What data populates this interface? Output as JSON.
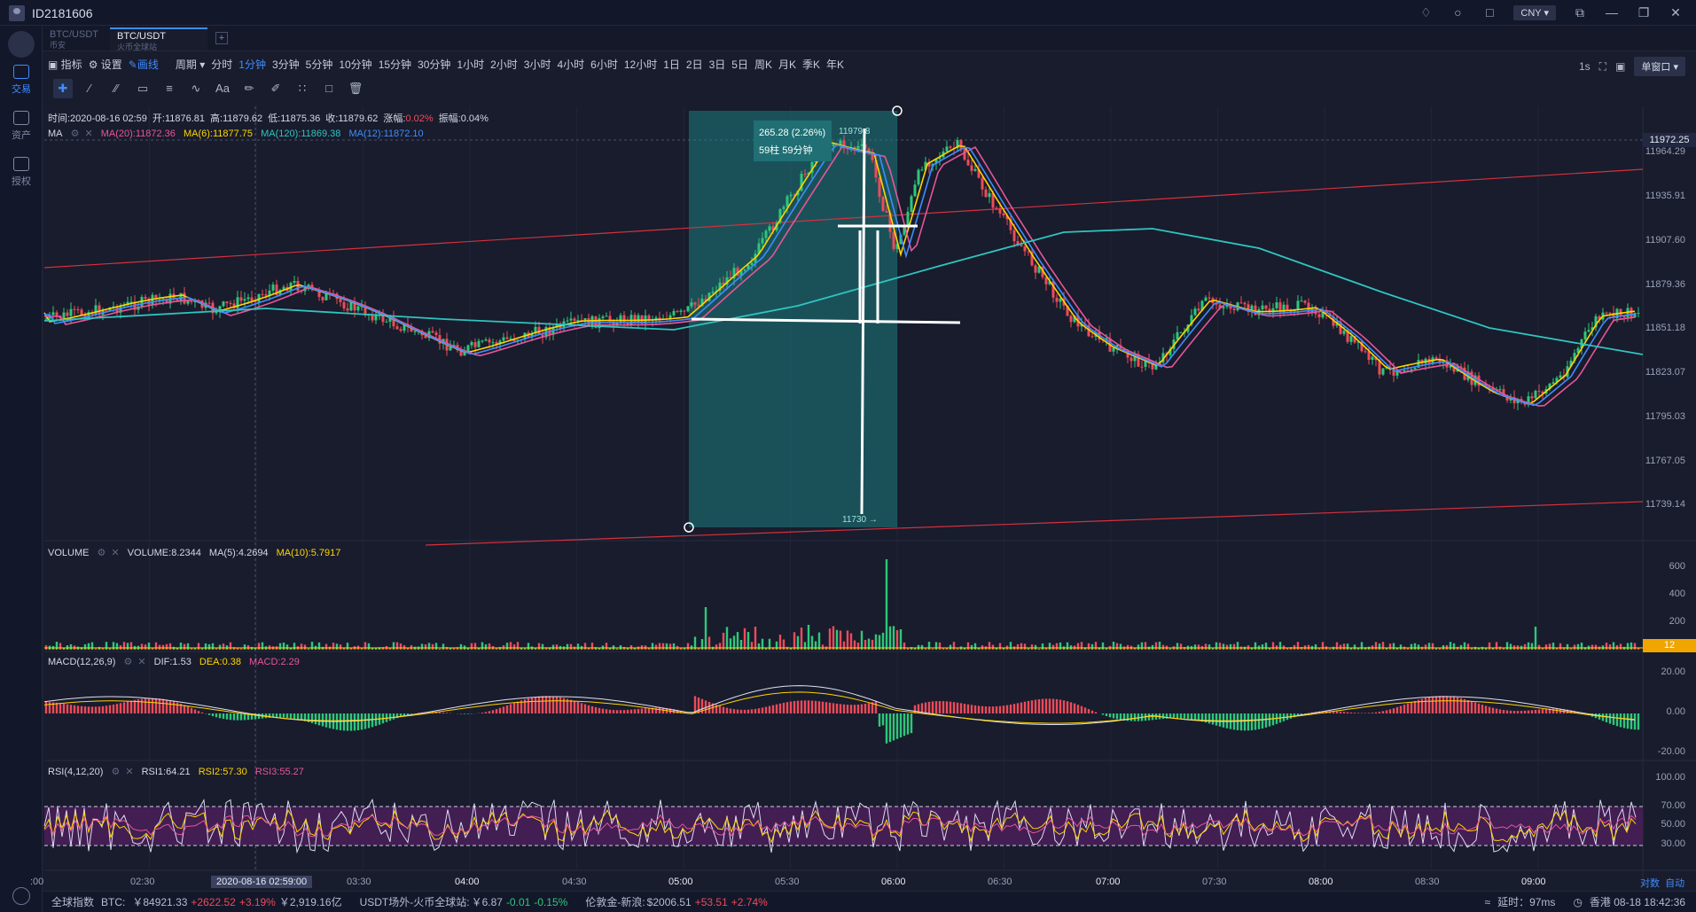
{
  "window": {
    "user_id": "ID2181606",
    "currency": "CNY"
  },
  "sidebar": {
    "items": [
      {
        "label": "交易",
        "icon": "trade-icon"
      },
      {
        "label": "资产",
        "icon": "wallet-icon"
      },
      {
        "label": "授权",
        "icon": "auth-icon"
      }
    ]
  },
  "tabs": [
    {
      "label": "BTC/USDT",
      "sub": "币安"
    },
    {
      "label": "BTC/USDT",
      "sub": "火币全球站"
    }
  ],
  "toolbar": {
    "indicator": "指标",
    "settings": "设置",
    "draw": "画线",
    "period": "周期",
    "intervals": [
      "分时",
      "1分钟",
      "3分钟",
      "5分钟",
      "10分钟",
      "15分钟",
      "30分钟",
      "1小时",
      "2小时",
      "3小时",
      "4小时",
      "6小时",
      "12小时",
      "1日",
      "2日",
      "3日",
      "5日",
      "周K",
      "月K",
      "季K",
      "年K"
    ],
    "active_interval": "1分钟",
    "refresh": "1s",
    "window_mode": "单窗口"
  },
  "info_line": {
    "time": "时间:2020-08-16 02:59",
    "open": "开:11876.81",
    "high": "高:11879.62",
    "low": "低:11875.36",
    "close": "收:11879.62",
    "change_label": "涨幅:",
    "change_value": "0.02%",
    "amplitude": "振幅:0.04%"
  },
  "ma_line": {
    "name": "MA",
    "ma20": "MA(20):11872.36",
    "ma6": "MA(6):11877.75",
    "ma120": "MA(120):11869.38",
    "ma12": "MA(12):11872.10"
  },
  "volume_line": {
    "name": "VOLUME",
    "vol": "VOLUME:8.2344",
    "ma5": "MA(5):4.2694",
    "ma10": "MA(10):5.7917"
  },
  "macd_line": {
    "name": "MACD(12,26,9)",
    "dif": "DIF:1.53",
    "dea": "DEA:0.38",
    "macd": "MACD:2.29"
  },
  "rsi_line": {
    "name": "RSI(4,12,20)",
    "rsi1": "RSI1:64.21",
    "rsi2": "RSI2:57.30",
    "rsi3": "RSI3:55.27"
  },
  "measure_box": {
    "change": "265.28 (2.26%)",
    "bars": "59柱 59分钟",
    "top_price": "11979.8",
    "bottom_price": "11730"
  },
  "price_axis": [
    "11964.29",
    "11935.91",
    "11907.60",
    "11879.36",
    "11851.18",
    "11823.07",
    "11795.03",
    "11767.05",
    "11739.14"
  ],
  "current_price": "11972.25",
  "volume_axis": [
    "600",
    "400",
    "200"
  ],
  "volume_current": "12",
  "macd_axis": [
    "20.00",
    "0.00",
    "-20.00"
  ],
  "rsi_axis": [
    "100.00",
    "70.00",
    "50.00",
    "30.00"
  ],
  "time_axis": [
    ":00",
    "02:30",
    "03:00",
    "03:30",
    "04:00",
    "04:30",
    "05:00",
    "05:30",
    "06:00",
    "06:30",
    "07:00",
    "07:30",
    "08:00",
    "08:30",
    "09:00"
  ],
  "crosshair_time": "2020-08-16 02:59:00",
  "axis_mode": {
    "pair": "对数",
    "auto": "自动"
  },
  "footer": {
    "index_label": "全球指数",
    "btc_label": "BTC:",
    "btc_price": "￥84921.33",
    "btc_change": "+2622.52",
    "btc_pct": "+3.19%",
    "btc_volume": "￥2,919.16亿",
    "usdt_label": "USDT场外-火币全球站:",
    "usdt_price": "￥6.87",
    "usdt_change": "-0.01",
    "usdt_pct": "-0.15%",
    "gold_label": "伦敦金-新浪:",
    "gold_price": "$2006.51",
    "gold_change": "+53.51",
    "gold_pct": "+2.74%",
    "latency": "延时：97ms",
    "location": "香港 08-18 18:42:36"
  },
  "colors": {
    "bg": "#181c2c",
    "up": "#ee4b5a",
    "down": "#2ec77a",
    "ma20": "#e8559a",
    "ma6": "#ffd400",
    "ma120": "#2fc4c0",
    "ma12": "#3f8cff",
    "accent": "#3f8cff"
  }
}
